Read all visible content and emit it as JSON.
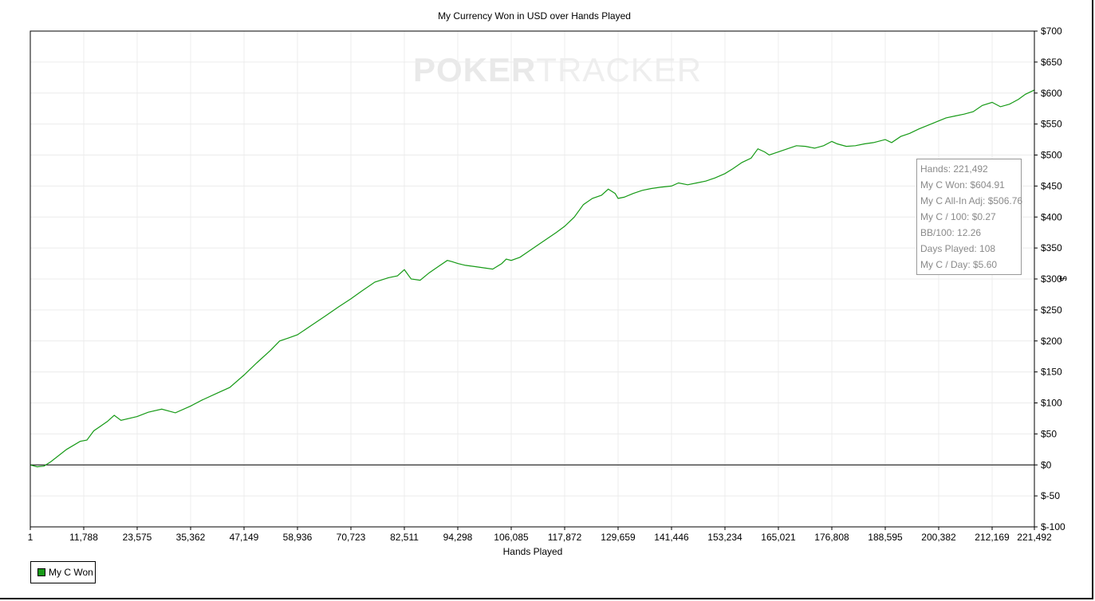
{
  "chart_data": {
    "type": "line",
    "title": "My Currency Won in USD over Hands Played",
    "xlabel": "Hands Played",
    "ylabel": "$",
    "xlim": [
      1,
      221492
    ],
    "ylim": [
      -100,
      700
    ],
    "x_ticks": [
      1,
      11788,
      23575,
      35362,
      47149,
      58936,
      70723,
      82511,
      94298,
      106085,
      117872,
      129659,
      141446,
      153234,
      165021,
      176808,
      188595,
      200382,
      212169,
      221492
    ],
    "x_tick_labels": [
      "1",
      "11,788",
      "23,575",
      "35,362",
      "47,149",
      "58,936",
      "70,723",
      "82,511",
      "94,298",
      "106,085",
      "117,872",
      "129,659",
      "141,446",
      "153,234",
      "165,021",
      "176,808",
      "188,595",
      "200,382",
      "212,169",
      "221,492"
    ],
    "y_ticks": [
      -100,
      -50,
      0,
      50,
      100,
      150,
      200,
      250,
      300,
      350,
      400,
      450,
      500,
      550,
      600,
      650,
      700
    ],
    "y_tick_labels": [
      "$-100",
      "$-50",
      "$0",
      "$50",
      "$100",
      "$150",
      "$200",
      "$250",
      "$300",
      "$350",
      "$400",
      "$450",
      "$500",
      "$550",
      "$600",
      "$650",
      "$700"
    ],
    "grid": true,
    "legend_position": "bottom-left",
    "series": [
      {
        "name": "My C Won",
        "color": "#169a16",
        "x": [
          1,
          1500,
          3000,
          4500,
          8000,
          11000,
          12500,
          14000,
          17000,
          18500,
          20000,
          23575,
          26000,
          29000,
          32000,
          35362,
          38000,
          41000,
          44000,
          47149,
          50000,
          53000,
          55000,
          57000,
          58936,
          62000,
          65000,
          68000,
          70723,
          73000,
          76000,
          79000,
          81000,
          82511,
          84000,
          86000,
          88000,
          90000,
          92000,
          93000,
          94298,
          96000,
          98000,
          100000,
          102000,
          104000,
          105000,
          106085,
          108000,
          110000,
          112000,
          114000,
          116000,
          117872,
          120000,
          122000,
          124000,
          126000,
          127500,
          129000,
          129659,
          131000,
          133000,
          135000,
          137000,
          139000,
          141446,
          143000,
          145000,
          147000,
          149000,
          151000,
          153234,
          155000,
          157000,
          159000,
          160500,
          162000,
          163000,
          165021,
          167000,
          169000,
          171000,
          173000,
          175000,
          176808,
          178000,
          180000,
          182000,
          184000,
          186000,
          188595,
          190000,
          192000,
          194000,
          196000,
          198000,
          200382,
          202000,
          204000,
          206000,
          208000,
          210000,
          212169,
          214000,
          216000,
          218000,
          219500,
          221492
        ],
        "y": [
          0,
          -3,
          -2,
          5,
          25,
          38,
          40,
          55,
          70,
          80,
          72,
          78,
          85,
          90,
          84,
          95,
          105,
          115,
          125,
          145,
          165,
          185,
          200,
          205,
          210,
          225,
          240,
          255,
          268,
          280,
          295,
          302,
          305,
          315,
          300,
          298,
          310,
          320,
          330,
          328,
          325,
          322,
          320,
          318,
          316,
          325,
          332,
          330,
          335,
          345,
          355,
          365,
          375,
          385,
          400,
          420,
          430,
          435,
          445,
          438,
          430,
          432,
          438,
          443,
          446,
          448,
          450,
          455,
          452,
          455,
          458,
          463,
          470,
          478,
          488,
          495,
          510,
          505,
          500,
          505,
          510,
          515,
          514,
          511,
          515,
          522,
          518,
          514,
          515,
          518,
          520,
          525,
          520,
          530,
          535,
          542,
          548,
          555,
          560,
          563,
          566,
          570,
          580,
          585,
          578,
          582,
          590,
          598,
          604.91
        ]
      }
    ]
  },
  "info_box": {
    "hands": "Hands: 221,492",
    "won": "My C Won: $604.91",
    "allin": "My C All-In Adj: $506.76",
    "per100": "My C / 100: $0.27",
    "bb100": "BB/100: 12.26",
    "days": "Days Played: 108",
    "perday": "My C / Day: $5.60"
  },
  "watermark": {
    "part1": "POKER",
    "part2": "TRACKER"
  },
  "legend": {
    "label": "My C Won"
  }
}
